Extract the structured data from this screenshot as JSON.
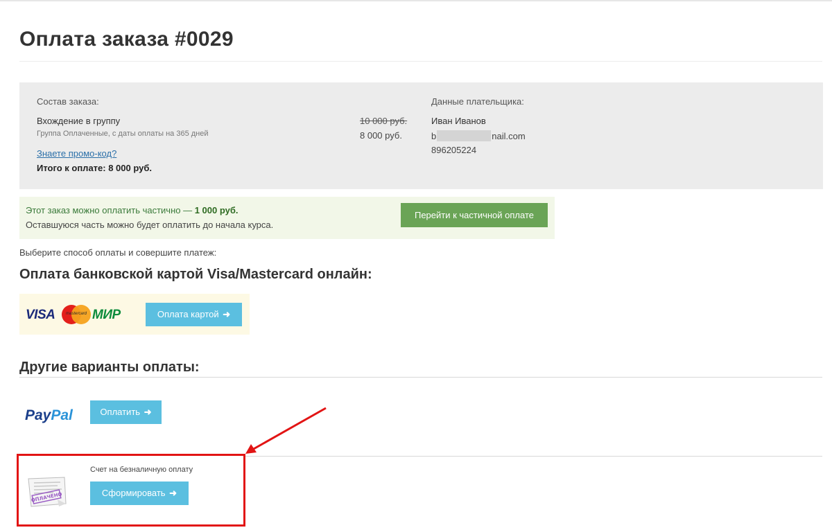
{
  "page": {
    "title": "Оплата заказа #0029"
  },
  "order": {
    "label": "Состав заказа:",
    "item_title": "Вхождение в группу",
    "item_desc": "Группа Оплаченные, с даты оплаты на 365 дней",
    "promo_link": "Знаете промо-код?",
    "total_label": "Итого к оплате: 8 000 руб.",
    "old_price": "10 000 руб.",
    "new_price": "8 000 руб."
  },
  "payer": {
    "label": "Данные плательщика:",
    "name": "Иван Иванов",
    "email_start": "b",
    "email_end": "nail.com",
    "phone": "896205224"
  },
  "partial": {
    "line1_text": "Этот заказ можно оплатить частично — ",
    "line1_amount": "1 000 руб.",
    "line2": "Оставшуюся часть можно будет оплатить до начала курса.",
    "button": "Перейти к частичной оплате"
  },
  "choose_text": "Выберите способ оплаты и совершите платеж:",
  "card": {
    "heading": "Оплата банковской картой Visa/Mastercard онлайн:",
    "logo_visa": "VISA",
    "logo_mastercard": "mastercard",
    "logo_mir": "МИР",
    "button": "Оплата картой"
  },
  "other": {
    "heading": "Другие варианты оплаты:",
    "paypal_pay": "Pay",
    "paypal_pal": "Pal",
    "paypal_button": "Оплатить"
  },
  "invoice": {
    "label": "Счет на безналичную оплату",
    "button": "Сформировать",
    "stamp": "ОПЛАЧЕНО"
  },
  "colors": {
    "accent_blue": "#5bbfe0",
    "green_button": "#6aa456",
    "highlight_red": "#e21414",
    "link": "#2a6fa8"
  },
  "icons": {
    "button_arrow": "arrow-right-icon"
  }
}
